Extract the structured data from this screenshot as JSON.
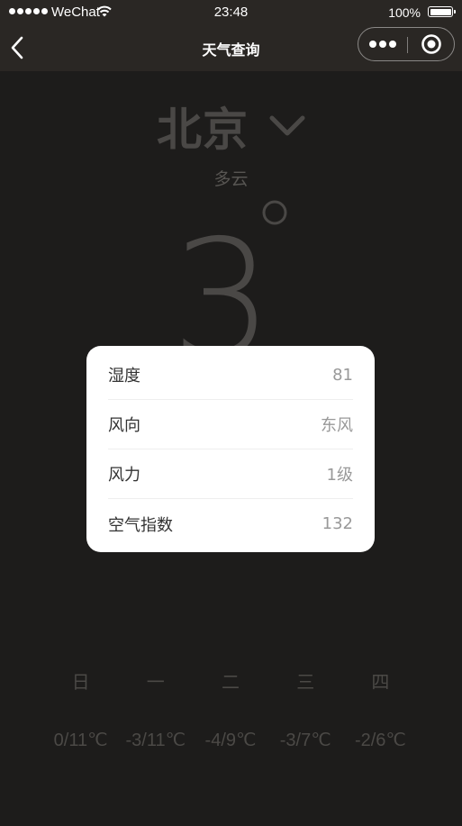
{
  "status_bar": {
    "carrier": "WeChat",
    "time": "23:48",
    "battery": "100%"
  },
  "nav": {
    "title": "天气查询"
  },
  "weather": {
    "city": "北京",
    "condition": "多云",
    "temperature": "3"
  },
  "details": [
    {
      "label": "湿度",
      "value": "81"
    },
    {
      "label": "风向",
      "value": "东风"
    },
    {
      "label": "风力",
      "value": "1级"
    },
    {
      "label": "空气指数",
      "value": "132"
    }
  ],
  "forecast": {
    "days": [
      "日",
      "一",
      "二",
      "三",
      "四"
    ],
    "temps": [
      "0/11℃",
      "-3/11℃",
      "-4/9℃",
      "-3/7℃",
      "-2/6℃"
    ]
  },
  "colors": {
    "background": "#1d1c1b",
    "nav_background": "#2a2724",
    "card_background": "#ffffff",
    "muted_text": "#4a4846"
  }
}
